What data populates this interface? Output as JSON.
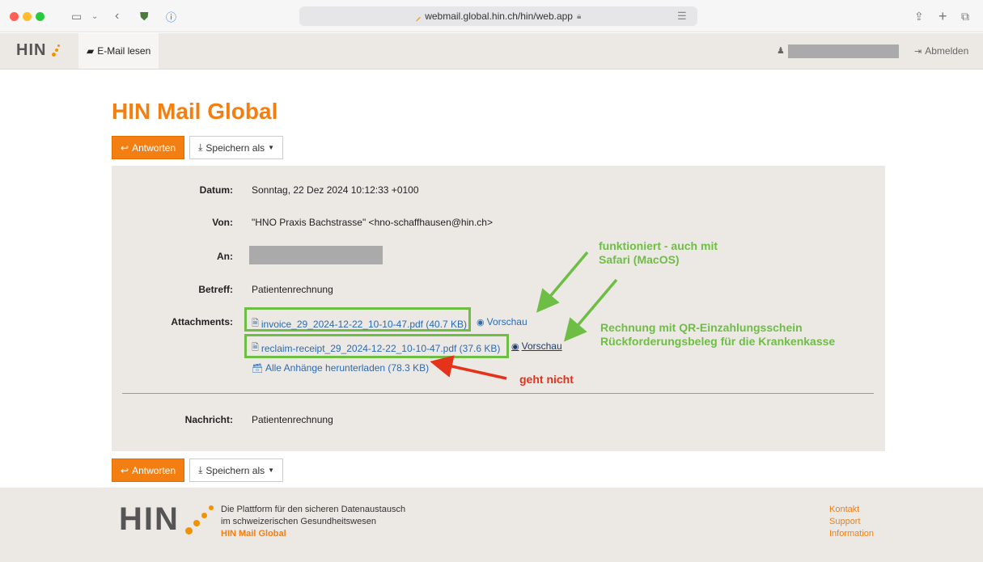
{
  "browser": {
    "url": "webmail.global.hin.ch/hin/web.app"
  },
  "nav": {
    "logo": "HIN",
    "read_mail": "E-Mail lesen",
    "logout": "Abmelden"
  },
  "page_title": "HIN Mail Global",
  "buttons": {
    "reply": "Antworten",
    "save_as": "Speichern als"
  },
  "mail": {
    "labels": {
      "date": "Datum:",
      "from": "Von:",
      "to": "An:",
      "subject": "Betreff:",
      "attachments": "Attachments:",
      "message": "Nachricht:"
    },
    "date": "Sonntag, 22 Dez 2024 10:12:33 +0100",
    "from": "\"HNO Praxis Bachstrasse\" <hno-schaffhausen@hin.ch>",
    "subject": "Patientenrechnung",
    "attachments": [
      {
        "name": "invoice_29_2024-12-22_10-10-47.pdf (40.7 KB)",
        "preview": "Vorschau"
      },
      {
        "name": "reclaim-receipt_29_2024-12-22_10-10-47.pdf (37.6 KB)",
        "preview": "Vorschau"
      }
    ],
    "download_all": "Alle Anhänge herunterladen (78.3 KB)",
    "message": "Patientenrechnung"
  },
  "annotations": {
    "works_line1": "funktioniert - auch mit",
    "works_line2": "Safari (MacOS)",
    "invoice_line1": "Rechnung mit QR-Einzahlungsschein",
    "invoice_line2": "Rückforderungsbeleg für die Krankenkasse",
    "broken": "geht nicht"
  },
  "footer": {
    "logo": "HIN",
    "tagline_line1": "Die Plattform für den sicheren Datenaustausch",
    "tagline_line2": "im schweizerischen Gesundheitswesen",
    "tagline_brand": "HIN Mail Global",
    "links": [
      "Kontakt",
      "Support",
      "Information"
    ]
  },
  "colors": {
    "accent": "#f37f13",
    "annotation_green": "#6ebd45",
    "annotation_red": "#e5321a"
  }
}
